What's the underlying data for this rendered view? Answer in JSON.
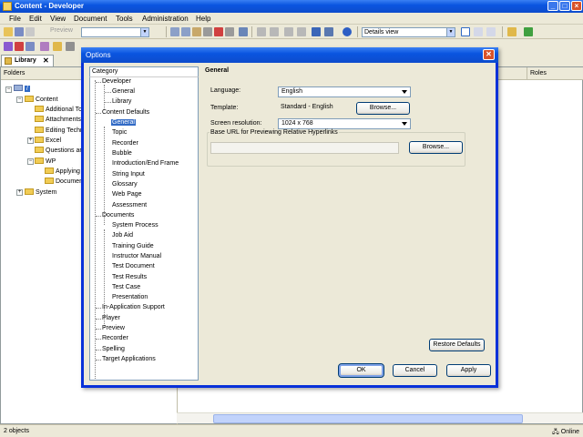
{
  "window": {
    "title": "Content - Developer"
  },
  "menu": [
    "File",
    "Edit",
    "View",
    "Document",
    "Tools",
    "Administration",
    "Help"
  ],
  "toolbar": {
    "preview_label": "Preview",
    "view_combo": "Details view"
  },
  "library": {
    "tab_label": "Library",
    "folders_header": "Folders",
    "roles_header": "Roles",
    "root_label": "/",
    "tree": [
      {
        "label": "Content",
        "level": 1,
        "expandable": true
      },
      {
        "label": "Additional Top",
        "level": 2
      },
      {
        "label": "Attachments",
        "level": 2
      },
      {
        "label": "Editing Techni",
        "level": 2
      },
      {
        "label": "Excel",
        "level": 2,
        "expandable": true
      },
      {
        "label": "Questions an",
        "level": 2
      },
      {
        "label": "WP",
        "level": 2,
        "expandable": true
      },
      {
        "label": "Applying F",
        "level": 3
      },
      {
        "label": "Documen",
        "level": 3
      },
      {
        "label": "System",
        "level": 1,
        "expandable": true
      }
    ]
  },
  "status": {
    "count": "2 objects",
    "online": "Online"
  },
  "dialog": {
    "title": "Options",
    "category_header": "Category",
    "categories": [
      {
        "label": "Developer",
        "level": 0
      },
      {
        "label": "General",
        "level": 1
      },
      {
        "label": "Library",
        "level": 1
      },
      {
        "label": "Content Defaults",
        "level": 0
      },
      {
        "label": "General",
        "level": 1,
        "selected": true
      },
      {
        "label": "Topic",
        "level": 1
      },
      {
        "label": "Recorder",
        "level": 1
      },
      {
        "label": "Bubble",
        "level": 1
      },
      {
        "label": "Introduction/End Frame",
        "level": 1
      },
      {
        "label": "String Input",
        "level": 1
      },
      {
        "label": "Glossary",
        "level": 1
      },
      {
        "label": "Web Page",
        "level": 1
      },
      {
        "label": "Assessment",
        "level": 1
      },
      {
        "label": "Documents",
        "level": 0
      },
      {
        "label": "System Process",
        "level": 1
      },
      {
        "label": "Job Aid",
        "level": 1
      },
      {
        "label": "Training Guide",
        "level": 1
      },
      {
        "label": "Instructor Manual",
        "level": 1
      },
      {
        "label": "Test Document",
        "level": 1
      },
      {
        "label": "Test Results",
        "level": 1
      },
      {
        "label": "Test Case",
        "level": 1
      },
      {
        "label": "Presentation",
        "level": 1
      },
      {
        "label": "In-Application Support",
        "level": 0
      },
      {
        "label": "Player",
        "level": 0
      },
      {
        "label": "Preview",
        "level": 0
      },
      {
        "label": "Recorder",
        "level": 0
      },
      {
        "label": "Spelling",
        "level": 0
      },
      {
        "label": "Target Applications",
        "level": 0
      }
    ],
    "section_title": "General",
    "language_label": "Language:",
    "language_value": "English",
    "template_label": "Template:",
    "template_value": "Standard - English",
    "browse_label": "Browse...",
    "resolution_label": "Screen resolution:",
    "resolution_value": "1024 x 768",
    "base_url_label": "Base URL for Previewing Relative Hyperlinks",
    "base_url_value": "",
    "browse2_label": "Browse...",
    "restore_label": "Restore Defaults",
    "ok_label": "OK",
    "cancel_label": "Cancel",
    "apply_label": "Apply"
  }
}
